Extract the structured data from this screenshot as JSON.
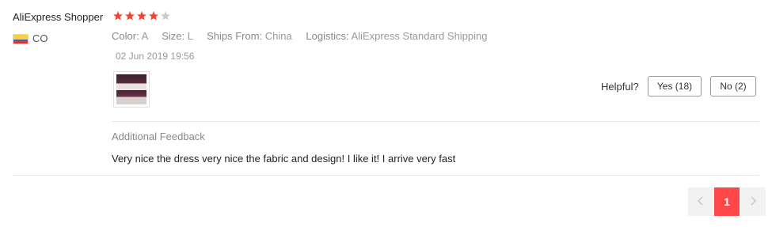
{
  "review": {
    "user_name": "AliExpress Shopper",
    "rating": 4,
    "rating_max": 5,
    "star_filled_color": "#f44336",
    "star_empty_color": "#cccccc",
    "country_code": "CO",
    "attributes": [
      {
        "label": "Color:",
        "value": "A"
      },
      {
        "label": "Size:",
        "value": "L"
      },
      {
        "label": "Ships From:",
        "value": "China"
      },
      {
        "label": "Logistics:",
        "value": "AliExpress Standard Shipping"
      }
    ],
    "date": "02 Jun 2019 19:56",
    "helpful_label": "Helpful?",
    "yes_label": "Yes (18)",
    "no_label": "No (2)",
    "additional_feedback_title": "Additional Feedback",
    "feedback_text": "Very nice the dress very nice the fabric and design! I like it! I arrive very fast"
  },
  "pagination": {
    "prev_icon": "chevron-left-icon",
    "current_page": "1",
    "next_icon": "chevron-right-icon",
    "accent_color": "#ff4747"
  }
}
